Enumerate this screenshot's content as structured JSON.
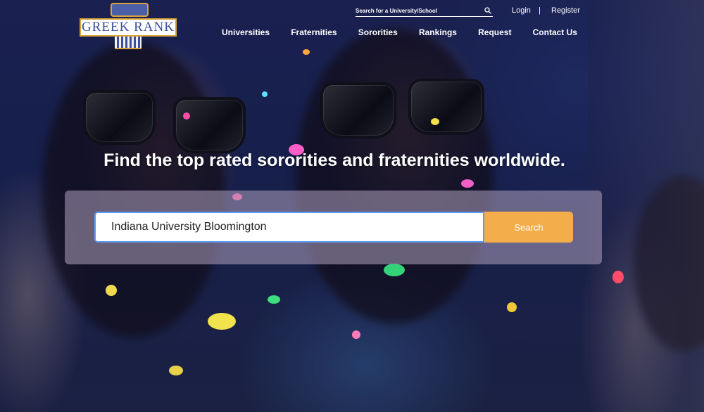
{
  "brand": {
    "logo_text": "GREEK RANK"
  },
  "header": {
    "search_placeholder": "Search for a University/School",
    "search_icon": "search-icon",
    "login_label": "Login",
    "separator": "|",
    "register_label": "Register"
  },
  "nav": {
    "items": [
      {
        "label": "Universities"
      },
      {
        "label": "Fraternities"
      },
      {
        "label": "Sororities"
      },
      {
        "label": "Rankings"
      },
      {
        "label": "Request"
      },
      {
        "label": "Contact Us"
      }
    ]
  },
  "hero": {
    "headline": "Find the top rated sororities and fraternities worldwide.",
    "search_value": "Indiana University Bloomington",
    "search_button_label": "Search"
  },
  "colors": {
    "accent_orange": "#f4ad4b",
    "brand_blue": "#3b4f9e",
    "brand_gold": "#d9a33a",
    "input_focus_border": "#5b9bf2"
  }
}
